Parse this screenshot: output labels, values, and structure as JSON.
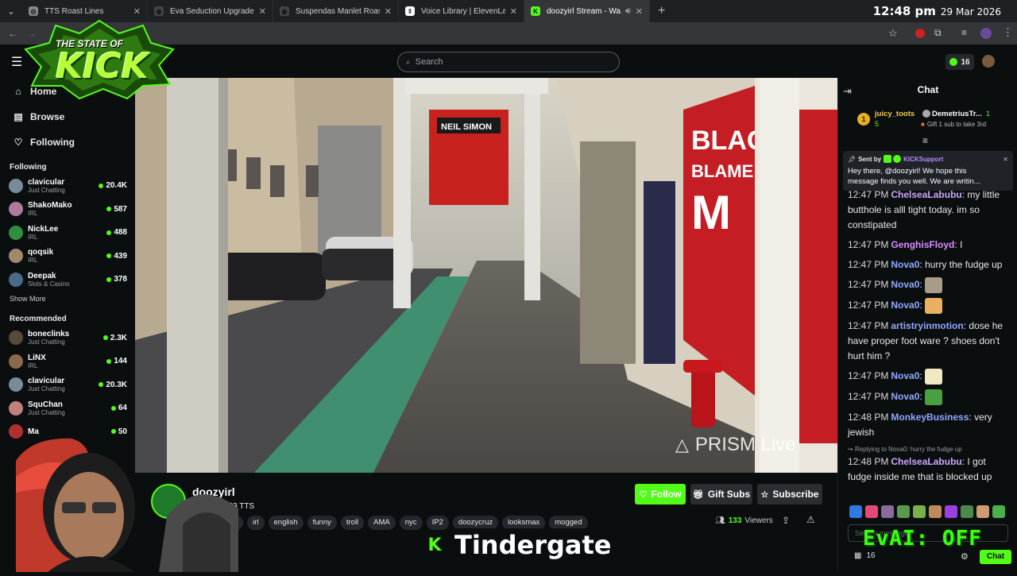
{
  "browser": {
    "tabs": [
      {
        "title": "TTS Roast Lines",
        "icon": "globe-icon",
        "active": false
      },
      {
        "title": "Eva Seduction Upgrade: Archet",
        "icon": "chatgpt-icon",
        "active": false
      },
      {
        "title": "Suspendas Manlet Roasts & T",
        "icon": "chatgpt-icon",
        "active": false
      },
      {
        "title": "Voice Library | ElevenLabs",
        "icon": "elevenlabs-icon",
        "active": false
      },
      {
        "title": "doozyirl Stream - Watch Li",
        "icon": "kick-icon",
        "active": true
      }
    ],
    "clock_time": "12:48 pm",
    "clock_date": "29 Mar 2026"
  },
  "header": {
    "search_placeholder": "Search",
    "notification_count": "16"
  },
  "overlay": {
    "logo_line1": "THE STATE OF",
    "logo_line2": "KICK",
    "banner_text": "Tindergate",
    "eva_status": "EvAI: OFF",
    "watermark": "PRISM Live"
  },
  "sidebar": {
    "nav": [
      {
        "label": "Home",
        "icon": "home-icon"
      },
      {
        "label": "Browse",
        "icon": "browse-icon"
      },
      {
        "label": "Following",
        "icon": "heart-icon"
      }
    ],
    "following_title": "Following",
    "following": [
      {
        "name": "clavicular",
        "category": "Just Chatting",
        "viewers": "20.4K",
        "color": "#7a8a9a"
      },
      {
        "name": "ShakoMako",
        "category": "IRL",
        "viewers": "587",
        "color": "#b07a9a"
      },
      {
        "name": "NickLee",
        "category": "IRL",
        "viewers": "488",
        "color": "#2f8f3f"
      },
      {
        "name": "qoqsik",
        "category": "IRL",
        "viewers": "439",
        "color": "#a08a6a"
      },
      {
        "name": "Deepak",
        "category": "Slots & Casino",
        "viewers": "378",
        "color": "#4a6a8a"
      }
    ],
    "show_more": "Show More",
    "recommended_title": "Recommended",
    "recommended": [
      {
        "name": "boneclinks",
        "category": "Just Chatting",
        "viewers": "2.3K",
        "color": "#5a4a3a"
      },
      {
        "name": "LiNX",
        "category": "IRL",
        "viewers": "144",
        "color": "#8a6a4a"
      },
      {
        "name": "clavicular",
        "category": "Just Chatting",
        "viewers": "20.3K",
        "color": "#7a8a9a"
      },
      {
        "name": "SquChan",
        "category": "Just Chatting",
        "viewers": "64",
        "color": "#c08080"
      },
      {
        "name": "Ma",
        "category": "",
        "viewers": "50",
        "color": "#b03030"
      }
    ]
  },
  "stream": {
    "channel": "doozyirl",
    "subtitle": "IRL / $3 TTS",
    "tags": [
      "english",
      "irl",
      "english",
      "funny",
      "troll",
      "AMA",
      "nyc",
      "IP2",
      "doozycruz",
      "looksmax",
      "mogged"
    ],
    "viewers": "133",
    "viewers_label": "Viewers",
    "follow_label": "Follow",
    "gift_label": "Gift Subs",
    "subscribe_label": "Subscribe"
  },
  "chat": {
    "title": "Chat",
    "leaderboard": {
      "rank": "1",
      "user1": "juicy_toots",
      "user1_count": "5",
      "user2": "DemetriusTr...",
      "user2_count": "1",
      "user2_note": "Gift 1 sub to take 3rd"
    },
    "pinned": {
      "sent_by": "Sent by",
      "sender": "KICKSupport",
      "text": "Hey there, @doozyirl! We hope this message finds you well. We are writin..."
    },
    "messages": [
      {
        "time": "12:47 PM",
        "user": "ChelseaLabubu",
        "color": "#c9a6ff",
        "text": "my little butthole is alll tight today. im so constipated"
      },
      {
        "time": "12:47 PM",
        "user": "GenghisFloyd",
        "color": "#d98cff",
        "text": "I"
      },
      {
        "time": "12:47 PM",
        "user": "Nova0",
        "color": "#8fa9ff",
        "text": "hurry the fudge up"
      },
      {
        "time": "12:47 PM",
        "user": "Nova0",
        "color": "#8fa9ff",
        "text": "",
        "emote": "cat-emote"
      },
      {
        "time": "12:47 PM",
        "user": "Nova0",
        "color": "#8fa9ff",
        "text": "",
        "emote": "face-emote"
      },
      {
        "time": "12:47 PM",
        "user": "artistryinmotion",
        "color": "#8fa9ff",
        "text": "dose he have proper foot ware ? shoes don't hurt him ?"
      },
      {
        "time": "12:47 PM",
        "user": "Nova0",
        "color": "#8fa9ff",
        "text": "",
        "emote": "peach-emote"
      },
      {
        "time": "12:47 PM",
        "user": "Nova0",
        "color": "#8fa9ff",
        "text": "",
        "emote": "pepe-emote"
      },
      {
        "time": "12:48 PM",
        "user": "MonkeyBusiness",
        "color": "#8fa9ff",
        "text": "very jewish"
      },
      {
        "time": "12:48 PM",
        "user": "ChelseaLabubu",
        "color": "#c9a6ff",
        "text": "I got fudge inside me that is blocked up",
        "reply": "Replying to Nova0: hurry the fudge up"
      }
    ],
    "input_placeholder": "Send a message",
    "bottom_count": "16",
    "send_label": "Chat"
  }
}
